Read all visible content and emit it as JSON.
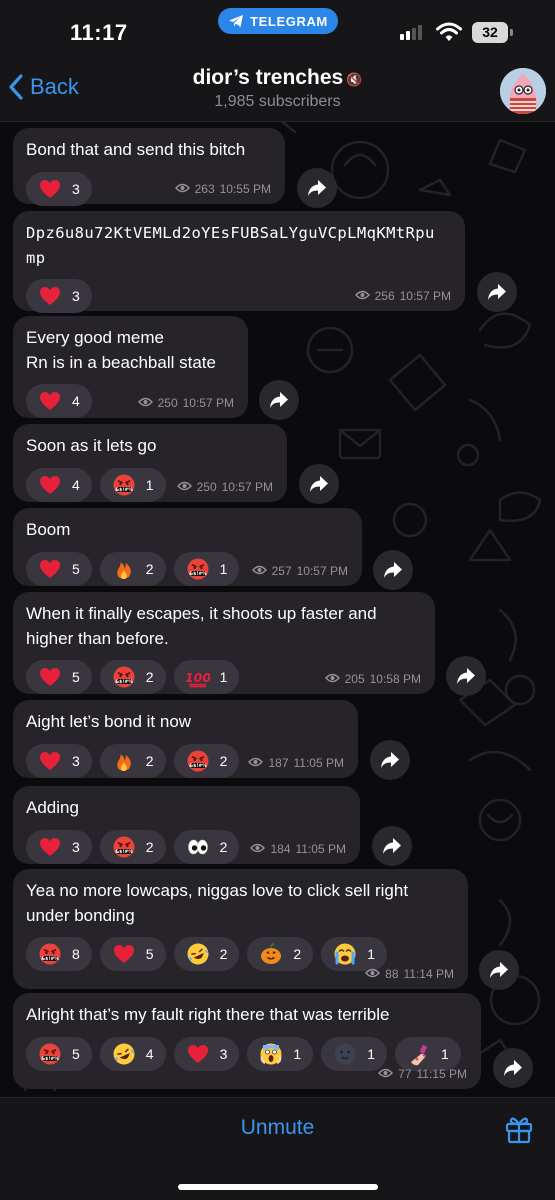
{
  "status_bar": {
    "time": "11:17",
    "app_pill": "TELEGRAM",
    "battery": "32"
  },
  "header": {
    "back_label": "Back",
    "title": "dior’s trenches",
    "subscribers": "1,985 subscribers"
  },
  "messages": [
    {
      "text": "Bond that and send this bitch",
      "mono": false,
      "reactions": [
        {
          "emoji": "heart",
          "count": "3"
        }
      ],
      "views": "263",
      "time": "10:55 PM"
    },
    {
      "text": "Dpz6u8u72KtVEMLd2oYEsFUBSaLYguVCpLMqKMtRpu\nmp",
      "mono": true,
      "reactions": [
        {
          "emoji": "heart",
          "count": "3"
        }
      ],
      "views": "256",
      "time": "10:57 PM"
    },
    {
      "text": "Every good meme\nRn is in a beachball state",
      "mono": false,
      "reactions": [
        {
          "emoji": "heart",
          "count": "4"
        }
      ],
      "views": "250",
      "time": "10:57 PM"
    },
    {
      "text": "Soon as it lets go",
      "mono": false,
      "reactions": [
        {
          "emoji": "heart",
          "count": "4"
        },
        {
          "emoji": "cursing",
          "count": "1"
        }
      ],
      "views": "250",
      "time": "10:57 PM"
    },
    {
      "text": "Boom",
      "mono": false,
      "reactions": [
        {
          "emoji": "heart",
          "count": "5"
        },
        {
          "emoji": "fire",
          "count": "2"
        },
        {
          "emoji": "cursing",
          "count": "1"
        }
      ],
      "views": "257",
      "time": "10:57 PM"
    },
    {
      "text": "When it finally escapes, it shoots up faster and\nhigher than before.",
      "mono": false,
      "reactions": [
        {
          "emoji": "heart",
          "count": "5"
        },
        {
          "emoji": "cursing",
          "count": "2"
        },
        {
          "emoji": "hundred",
          "count": "1"
        }
      ],
      "views": "205",
      "time": "10:58 PM"
    },
    {
      "text": "Aight let’s bond it now",
      "mono": false,
      "reactions": [
        {
          "emoji": "heart",
          "count": "3"
        },
        {
          "emoji": "fire",
          "count": "2"
        },
        {
          "emoji": "cursing",
          "count": "2"
        }
      ],
      "views": "187",
      "time": "11:05 PM"
    },
    {
      "text": "Adding",
      "mono": false,
      "reactions": [
        {
          "emoji": "heart",
          "count": "3"
        },
        {
          "emoji": "cursing",
          "count": "2"
        },
        {
          "emoji": "eyes",
          "count": "2"
        }
      ],
      "views": "184",
      "time": "11:05 PM"
    },
    {
      "text": "Yea no more lowcaps, niggas love to click sell right\nunder bonding",
      "mono": false,
      "reactions": [
        {
          "emoji": "cursing",
          "count": "8"
        },
        {
          "emoji": "heart",
          "count": "5"
        },
        {
          "emoji": "rofl",
          "count": "2"
        },
        {
          "emoji": "jack-o-lantern",
          "count": "2"
        },
        {
          "emoji": "crying",
          "count": "1"
        }
      ],
      "views": "88",
      "time": "11:14 PM"
    },
    {
      "text": "Alright that’s my fault right there that was terrible",
      "mono": false,
      "reactions": [
        {
          "emoji": "cursing",
          "count": "5"
        },
        {
          "emoji": "rofl",
          "count": "4"
        },
        {
          "emoji": "heart",
          "count": "3"
        },
        {
          "emoji": "scream",
          "count": "1"
        },
        {
          "emoji": "new-moon-face",
          "count": "1"
        },
        {
          "emoji": "nail-polish",
          "count": "1"
        }
      ],
      "views": "77",
      "time": "11:15 PM"
    }
  ],
  "bottom_bar": {
    "unmute_label": "Unmute"
  },
  "colors": {
    "accent": "#3a95ef",
    "bubble": "#262329",
    "reaction_pill": "#3a3640",
    "pill": "#2b86e8"
  }
}
